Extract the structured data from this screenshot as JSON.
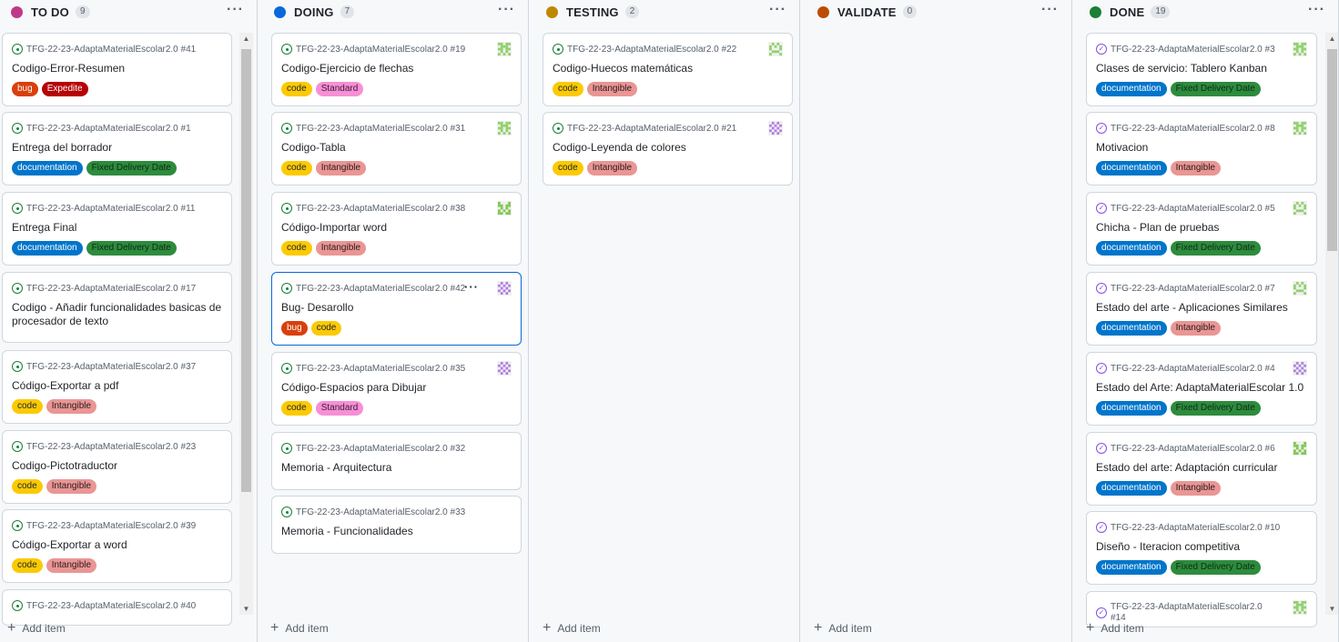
{
  "repo": "TFG-22-23-AdaptaMaterialEscolar2.0",
  "add_item_label": "Add item",
  "colors": {
    "bug": "#d93f0b",
    "Expedite": "#b60205",
    "documentation": "#0075ca",
    "Fixed Delivery Date": "#2e8b3e",
    "code": "#fbca04",
    "Standard": "#f78fd6",
    "Intangible": "#e99695"
  },
  "columns": [
    {
      "name": "TO DO",
      "count": "9",
      "dot": "#bf3989",
      "cards": [
        {
          "ref": "TFG-22-23-AdaptaMaterialEscolar2.0 #41",
          "title": "Codigo-Error-Resumen",
          "labels": [
            "bug",
            "Expedite"
          ],
          "status": "open"
        },
        {
          "ref": "TFG-22-23-AdaptaMaterialEscolar2.0 #1",
          "title": "Entrega del borrador",
          "labels": [
            "documentation",
            "Fixed Delivery Date"
          ],
          "status": "open"
        },
        {
          "ref": "TFG-22-23-AdaptaMaterialEscolar2.0 #11",
          "title": "Entrega Final",
          "labels": [
            "documentation",
            "Fixed Delivery Date"
          ],
          "status": "open"
        },
        {
          "ref": "TFG-22-23-AdaptaMaterialEscolar2.0 #17",
          "title": "Codigo - Añadir funcionalidades basicas de procesador de texto",
          "labels": [],
          "status": "open"
        },
        {
          "ref": "TFG-22-23-AdaptaMaterialEscolar2.0 #37",
          "title": "Código-Exportar a pdf",
          "labels": [
            "code",
            "Intangible"
          ],
          "status": "open"
        },
        {
          "ref": "TFG-22-23-AdaptaMaterialEscolar2.0 #23",
          "title": "Codigo-Pictotraductor",
          "labels": [
            "code",
            "Intangible"
          ],
          "status": "open"
        },
        {
          "ref": "TFG-22-23-AdaptaMaterialEscolar2.0 #39",
          "title": "Código-Exportar a word",
          "labels": [
            "code",
            "Intangible"
          ],
          "status": "open"
        },
        {
          "ref": "TFG-22-23-AdaptaMaterialEscolar2.0 #40",
          "title": "",
          "labels": [],
          "status": "open"
        }
      ]
    },
    {
      "name": "DOING",
      "count": "7",
      "dot": "#0969da",
      "cards": [
        {
          "ref": "TFG-22-23-AdaptaMaterialEscolar2.0 #19",
          "title": "Codigo-Ejercicio de flechas",
          "labels": [
            "code",
            "Standard"
          ],
          "status": "open",
          "avatar": "green-a"
        },
        {
          "ref": "TFG-22-23-AdaptaMaterialEscolar2.0 #31",
          "title": "Codigo-Tabla",
          "labels": [
            "code",
            "Intangible"
          ],
          "status": "open",
          "avatar": "green-a"
        },
        {
          "ref": "TFG-22-23-AdaptaMaterialEscolar2.0 #38",
          "title": "Código-Importar word",
          "labels": [
            "code",
            "Intangible"
          ],
          "status": "open",
          "avatar": "green-b"
        },
        {
          "ref": "TFG-22-23-AdaptaMaterialEscolar2.0 #42",
          "title": "Bug- Desarollo",
          "labels": [
            "bug",
            "code"
          ],
          "status": "open",
          "avatar": "purple",
          "selected": true
        },
        {
          "ref": "TFG-22-23-AdaptaMaterialEscolar2.0 #35",
          "title": "Código-Espacios para Dibujar",
          "labels": [
            "code",
            "Standard"
          ],
          "status": "open",
          "avatar": "purple"
        },
        {
          "ref": "TFG-22-23-AdaptaMaterialEscolar2.0 #32",
          "title": "Memoria - Arquitectura",
          "labels": [],
          "status": "open"
        },
        {
          "ref": "TFG-22-23-AdaptaMaterialEscolar2.0 #33",
          "title": "Memoria - Funcionalidades",
          "labels": [],
          "status": "open"
        }
      ]
    },
    {
      "name": "TESTING",
      "count": "2",
      "dot": "#bf8700",
      "cards": [
        {
          "ref": "TFG-22-23-AdaptaMaterialEscolar2.0 #22",
          "title": "Codigo-Huecos matemáticas",
          "labels": [
            "code",
            "Intangible"
          ],
          "status": "open",
          "avatar": "green-c"
        },
        {
          "ref": "TFG-22-23-AdaptaMaterialEscolar2.0 #21",
          "title": "Codigo-Leyenda de colores",
          "labels": [
            "code",
            "Intangible"
          ],
          "status": "open",
          "avatar": "purple"
        }
      ]
    },
    {
      "name": "VALIDATE",
      "count": "0",
      "dot": "#bc4c00",
      "cards": []
    },
    {
      "name": "DONE",
      "count": "19",
      "dot": "#1a7f37",
      "cards": [
        {
          "ref": "TFG-22-23-AdaptaMaterialEscolar2.0 #3",
          "title": "Clases de servicio: Tablero Kanban",
          "labels": [
            "documentation",
            "Fixed Delivery Date"
          ],
          "status": "done",
          "avatar": "green-a"
        },
        {
          "ref": "TFG-22-23-AdaptaMaterialEscolar2.0 #8",
          "title": "Motivacion",
          "labels": [
            "documentation",
            "Intangible"
          ],
          "status": "done",
          "avatar": "green-a"
        },
        {
          "ref": "TFG-22-23-AdaptaMaterialEscolar2.0 #5",
          "title": "Chicha - Plan de pruebas",
          "labels": [
            "documentation",
            "Fixed Delivery Date"
          ],
          "status": "done",
          "avatar": "green-c"
        },
        {
          "ref": "TFG-22-23-AdaptaMaterialEscolar2.0 #7",
          "title": "Estado del arte - Aplicaciones Similares",
          "labels": [
            "documentation",
            "Intangible"
          ],
          "status": "done",
          "avatar": "green-c"
        },
        {
          "ref": "TFG-22-23-AdaptaMaterialEscolar2.0 #4",
          "title": "Estado del Arte: AdaptaMaterialEscolar 1.0",
          "labels": [
            "documentation",
            "Fixed Delivery Date"
          ],
          "status": "done",
          "avatar": "purple"
        },
        {
          "ref": "TFG-22-23-AdaptaMaterialEscolar2.0 #6",
          "title": "Estado del arte: Adaptación curricular",
          "labels": [
            "documentation",
            "Intangible"
          ],
          "status": "done",
          "avatar": "green-b"
        },
        {
          "ref": "TFG-22-23-AdaptaMaterialEscolar2.0 #10",
          "title": "Diseño - Iteracion competitiva",
          "labels": [
            "documentation",
            "Fixed Delivery Date"
          ],
          "status": "done"
        },
        {
          "ref": "TFG-22-23-AdaptaMaterialEscolar2.0 #14",
          "title": "",
          "labels": [],
          "status": "done",
          "avatar": "green-a",
          "wrap": true
        }
      ]
    }
  ]
}
